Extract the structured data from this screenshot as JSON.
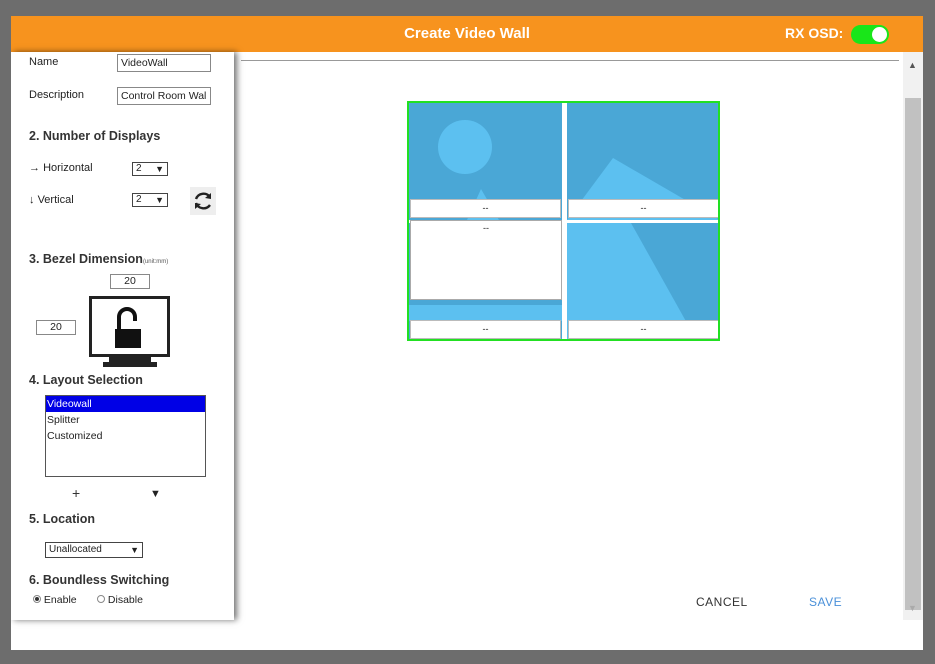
{
  "dialog": {
    "title": "Create Video Wall",
    "osd_label": "RX OSD:",
    "osd_on": true
  },
  "form": {
    "name_label": "Name",
    "name_value": "VideoWall",
    "description_label": "Description",
    "description_value": "Control Room Wal",
    "displays_heading": "2. Number of Displays",
    "horizontal_label": "Horizontal",
    "horizontal_value": "2",
    "vertical_label": "Vertical",
    "vertical_value": "2",
    "bezel_heading": "3. Bezel Dimension",
    "bezel_unit": "(unit:mm)",
    "bezel_top": "20",
    "bezel_side": "20",
    "layout_heading": "4. Layout Selection",
    "layout_options": [
      "Videowall",
      "Splitter",
      "Customized"
    ],
    "layout_selected": "Videowall",
    "location_heading": "5. Location",
    "location_value": "Unallocated",
    "boundless_heading": "6. Boundless Switching",
    "enable_label": "Enable",
    "disable_label": "Disable",
    "boundless_selected": "Enable"
  },
  "wall": {
    "captions": [
      "--",
      "--",
      "--",
      "--",
      "--"
    ]
  },
  "actions": {
    "cancel": "CANCEL",
    "save": "SAVE"
  },
  "colors": {
    "title_bar": "#f7931e",
    "toggle": "#19e619",
    "wall_border": "#22e022",
    "list_selection": "#0000e6",
    "save": "#4a90d9",
    "tile": "#4aa7d6"
  }
}
